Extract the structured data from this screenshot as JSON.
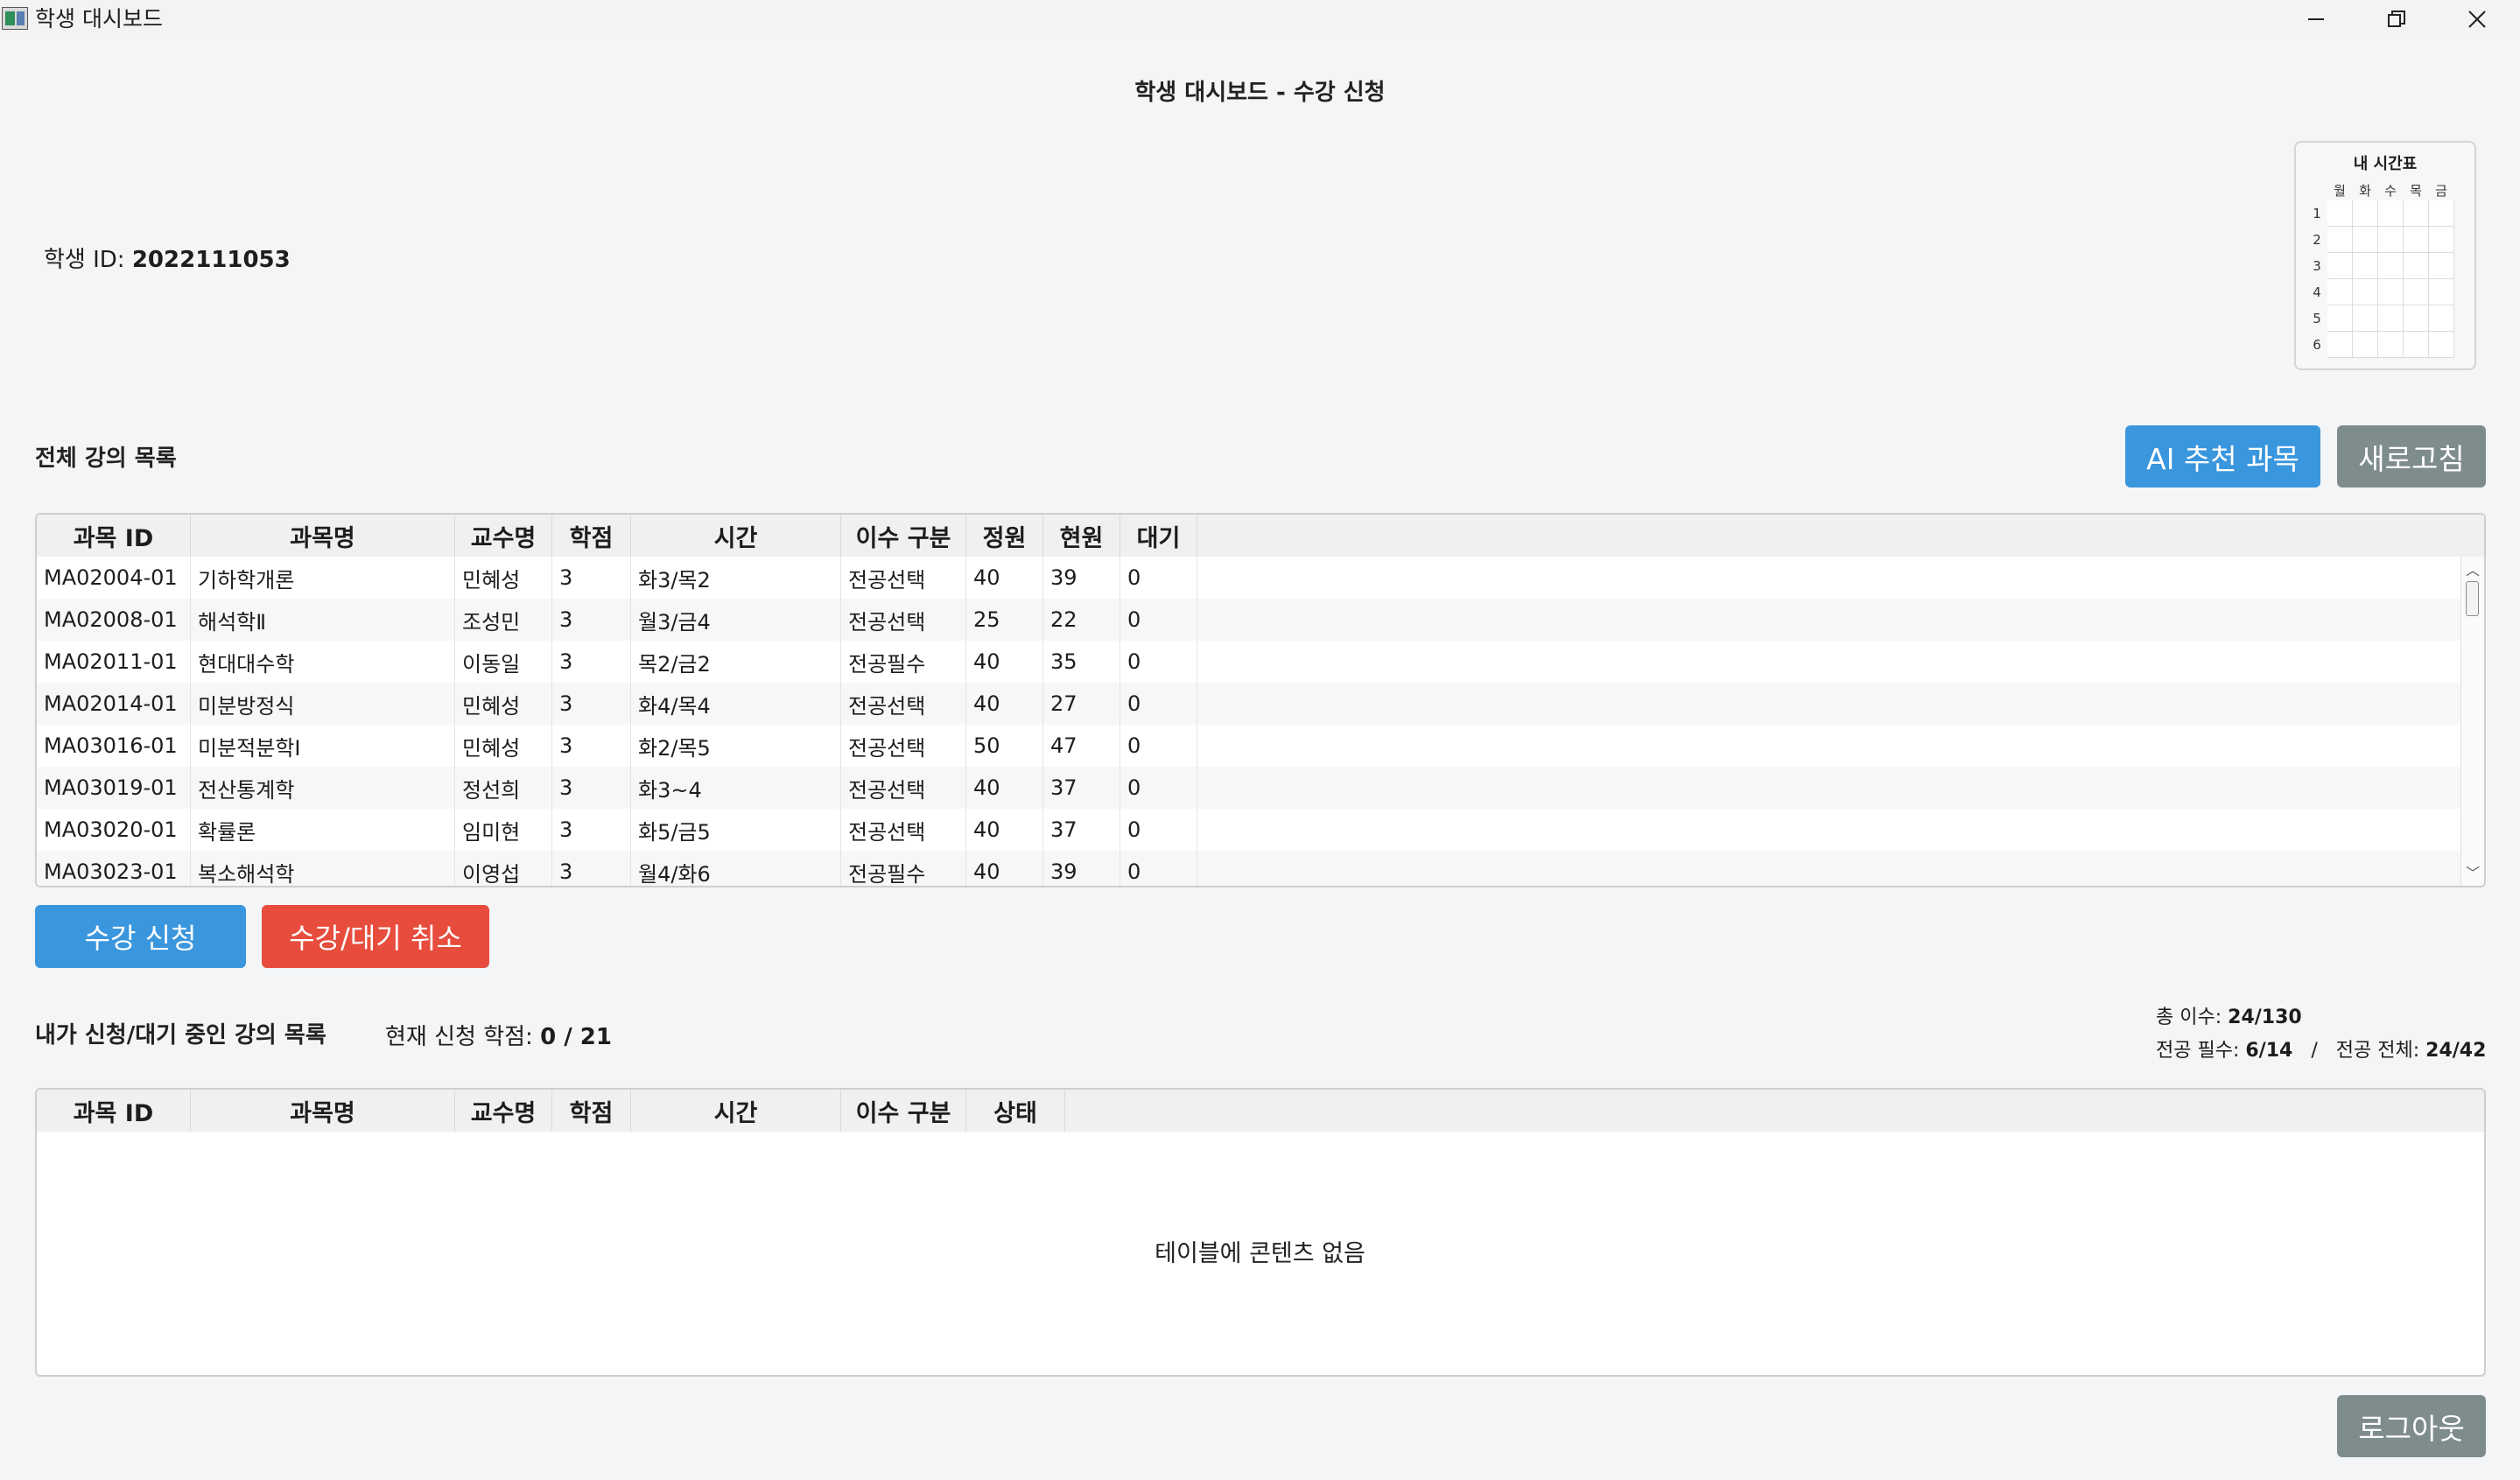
{
  "window": {
    "title": "학생 대시보드"
  },
  "header": {
    "heading": "학생 대시보드 - 수강 신청"
  },
  "student": {
    "id_label": "학생 ID:",
    "id_value": "2022111053"
  },
  "timetable": {
    "title": "내 시간표",
    "days": [
      "월",
      "화",
      "수",
      "목",
      "금"
    ],
    "periods": [
      "1",
      "2",
      "3",
      "4",
      "5",
      "6"
    ]
  },
  "all_courses": {
    "title": "전체 강의 목록",
    "ai_button": "AI 추천 과목",
    "refresh_button": "새로고침",
    "columns": [
      "과목 ID",
      "과목명",
      "교수명",
      "학점",
      "시간",
      "이수 구분",
      "정원",
      "현원",
      "대기"
    ],
    "rows": [
      [
        "MA02004-01",
        "기하학개론",
        "민혜성",
        "3",
        "화3/목2",
        "전공선택",
        "40",
        "39",
        "0"
      ],
      [
        "MA02008-01",
        "해석학Ⅱ",
        "조성민",
        "3",
        "월3/금4",
        "전공선택",
        "25",
        "22",
        "0"
      ],
      [
        "MA02011-01",
        "현대대수학",
        "이동일",
        "3",
        "목2/금2",
        "전공필수",
        "40",
        "35",
        "0"
      ],
      [
        "MA02014-01",
        "미분방정식",
        "민혜성",
        "3",
        "화4/목4",
        "전공선택",
        "40",
        "27",
        "0"
      ],
      [
        "MA03016-01",
        "미분적분학Ⅰ",
        "민혜성",
        "3",
        "화2/목5",
        "전공선택",
        "50",
        "47",
        "0"
      ],
      [
        "MA03019-01",
        "전산통계학",
        "정선희",
        "3",
        "화3~4",
        "전공선택",
        "40",
        "37",
        "0"
      ],
      [
        "MA03020-01",
        "확률론",
        "임미현",
        "3",
        "화5/금5",
        "전공선택",
        "40",
        "37",
        "0"
      ],
      [
        "MA03023-01",
        "복소해석학",
        "이영섭",
        "3",
        "월4/화6",
        "전공필수",
        "40",
        "39",
        "0"
      ]
    ]
  },
  "actions": {
    "enroll": "수강 신청",
    "cancel": "수강/대기 취소"
  },
  "my_courses": {
    "title": "내가 신청/대기 중인 강의 목록",
    "credit_label": "현재 신청 학점:",
    "credit_value": "0 / 21",
    "columns": [
      "과목 ID",
      "과목명",
      "교수명",
      "학점",
      "시간",
      "이수 구분",
      "상태"
    ],
    "empty_message": "테이블에 콘텐츠 없음"
  },
  "summary": {
    "total_label": "총 이수:",
    "total_value": "24/130",
    "major_req_label": "전공 필수:",
    "major_req_value": "6/14",
    "separator": "/",
    "major_all_label": "전공 전체:",
    "major_all_value": "24/42"
  },
  "footer": {
    "logout": "로그아웃"
  }
}
